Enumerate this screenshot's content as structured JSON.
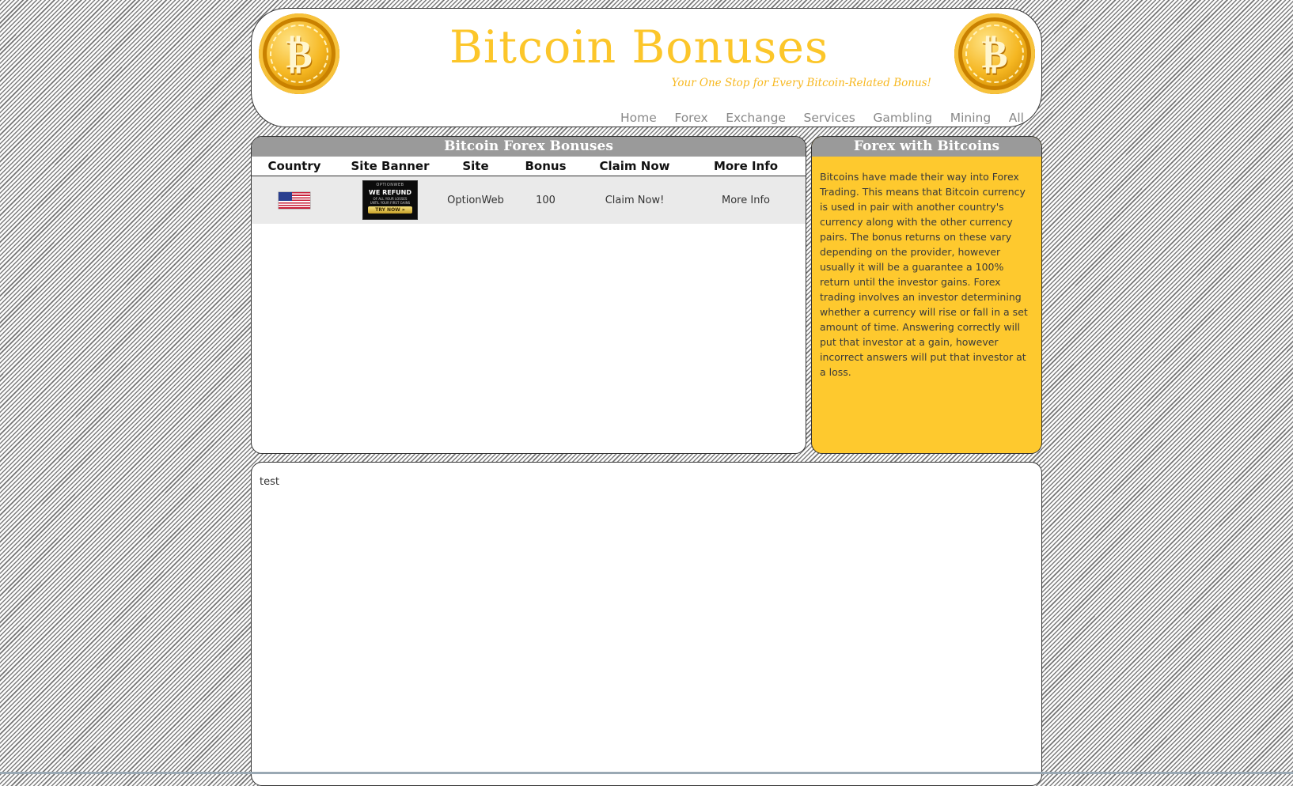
{
  "header": {
    "title": "Bitcoin Bonuses",
    "tagline": "Your One Stop for Every Bitcoin-Related Bonus!",
    "logo_icon": "bitcoin-coin-icon",
    "nav": [
      {
        "label": "Home"
      },
      {
        "label": "Forex"
      },
      {
        "label": "Exchange"
      },
      {
        "label": "Services"
      },
      {
        "label": "Gambling"
      },
      {
        "label": "Mining"
      },
      {
        "label": "All"
      }
    ]
  },
  "bonus_table": {
    "heading": "Bitcoin Forex Bonuses",
    "columns": [
      "Country",
      "Site Banner",
      "Site",
      "Bonus",
      "Claim Now",
      "More Info"
    ],
    "rows": [
      {
        "country_icon": "us-flag-icon",
        "banner": {
          "brand": "OPTIONWEB",
          "headline": "WE REFUND",
          "line1": "OF ALL YOUR LOSSES",
          "line2": "UNTIL YOUR FIRST GAINS",
          "cta": "TRY NOW »"
        },
        "site": "OptionWeb",
        "bonus": "100",
        "claim": "Claim Now!",
        "more_info": "More Info"
      }
    ]
  },
  "side_panel": {
    "heading": "Forex with Bitcoins",
    "body": "Bitcoins have made their way into Forex Trading. This means that Bitcoin currency is used in pair with another country's currency along with the other currency pairs. The bonus returns on these vary depending on the provider, however usually it will be a guarantee a 100% return until the investor gains. Forex trading involves an investor determining whether a currency will rise or fall in a set amount of time. Answering correctly will put that investor at a gain, however incorrect answers will put that investor at a loss."
  },
  "content": {
    "text": "test"
  },
  "colors": {
    "accent_gold": "#fcc62a",
    "side_panel_bg": "#fec92e",
    "panel_header_gray": "#9a9a9a",
    "nav_text": "#888888"
  }
}
